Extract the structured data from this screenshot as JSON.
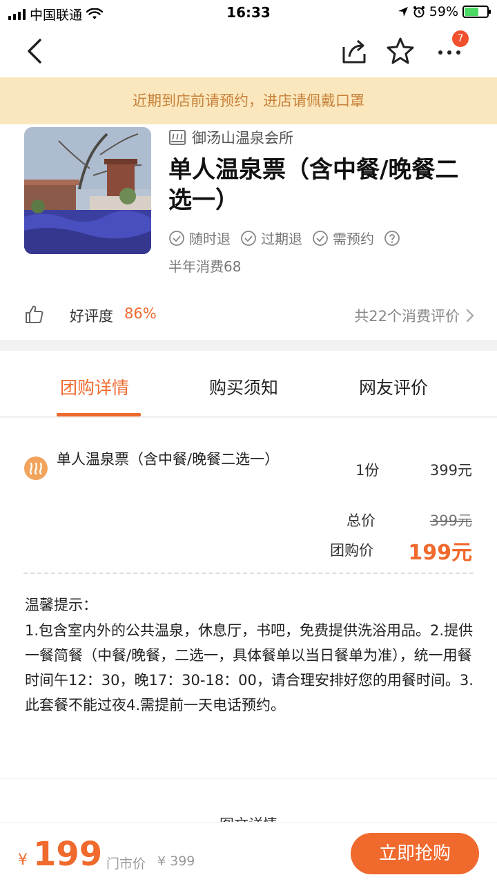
{
  "status_bar": {
    "carrier": "中国联通",
    "time": "16:33",
    "battery": "59%"
  },
  "nav": {
    "badge_count": "7",
    "icons": [
      "back-icon",
      "share-icon",
      "star-icon",
      "more-icon"
    ]
  },
  "notice": "近期到店前请预约，进店请佩戴口罩",
  "product": {
    "shop_name": "御汤山温泉会所",
    "title": "单人温泉票（含中餐/晚餐二选一）",
    "tags": [
      "随时退",
      "过期退",
      "需预约"
    ],
    "sales": "半年消费68",
    "rating_label": "好评度",
    "rating_value": "86%",
    "reviews_link": "共22个消费评价"
  },
  "tabs": [
    "团购详情",
    "购买须知",
    "网友评价"
  ],
  "detail": {
    "item_name": "单人温泉票（含中餐/晚餐二选一）",
    "item_qty": "1份",
    "item_price": "399元",
    "total_label": "总价",
    "total_value": "399元",
    "group_label": "团购价",
    "group_value": "199元",
    "tip_title": "温馨提示：",
    "tip_body": "1.包含室内外的公共温泉，休息厅，书吧，免费提供洗浴用品。2.提供一餐简餐（中餐/晚餐，二选一，具体餐单以当日餐单为准），统一用餐时间午12：30，晚17：30-18：00，请合理安排好您的用餐时间。3.此套餐不能过夜4.需提前一天电话预约。"
  },
  "section2_title": "图文详情",
  "bottom": {
    "currency": "¥",
    "price": "199",
    "market_label": "门市价",
    "market_value": "¥ 399",
    "buy_label": "立即抢购"
  },
  "colors": {
    "accent": "#f0692d",
    "notice_bg": "#fbe7bd",
    "notice_text": "#c7823a"
  }
}
